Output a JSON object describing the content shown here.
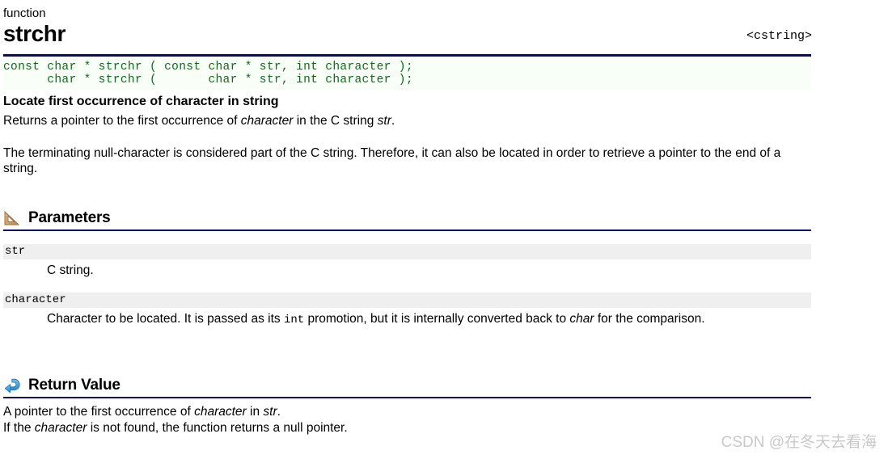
{
  "colors": {
    "rule_navy": "#0a0a64",
    "code_text_green": "#14691e",
    "code_bg": "#f7fff7",
    "param_band_gray": "#efefef",
    "watermark_gray": "#c9c9c9",
    "return_icon_blue": "#3c9ee0",
    "ruler_icon_tan": "#d8b083"
  },
  "header": {
    "kind": "function",
    "title": "strchr",
    "include": "<cstring>"
  },
  "prototype": {
    "lines": [
      "const char * strchr ( const char * str, int character );",
      "      char * strchr (       char * str, int character );"
    ]
  },
  "description": {
    "headline": "Locate first occurrence of character in string",
    "paragraph1_parts": [
      {
        "text": "Returns a pointer to the first occurrence of ",
        "style": "normal"
      },
      {
        "text": "character",
        "style": "italic"
      },
      {
        "text": " in the C string ",
        "style": "normal"
      },
      {
        "text": "str",
        "style": "italic"
      },
      {
        "text": ".",
        "style": "normal"
      }
    ],
    "paragraph1_plain": "Returns a pointer to the first occurrence of character in the C string str.",
    "paragraph2": "The terminating null-character is considered part of the C string. Therefore, it can also be located in order to retrieve a pointer to the end of a string."
  },
  "sections": {
    "parameters": {
      "icon": "ruler-triangle-icon",
      "title": "Parameters",
      "items": [
        {
          "name": "str",
          "description_plain": "C string.",
          "description_parts": [
            {
              "text": "C string.",
              "style": "normal"
            }
          ]
        },
        {
          "name": "character",
          "description_plain": "Character to be located. It is passed as its int promotion, but it is internally converted back to char for the comparison.",
          "description_parts": [
            {
              "text": "Character to be located. It is passed as its ",
              "style": "normal"
            },
            {
              "text": "int",
              "style": "mono"
            },
            {
              "text": " promotion, but it is internally converted back to ",
              "style": "normal"
            },
            {
              "text": "char",
              "style": "italic"
            },
            {
              "text": " for the comparison.",
              "style": "normal"
            }
          ]
        }
      ]
    },
    "return_value": {
      "icon": "return-arrow-icon",
      "title": "Return Value",
      "lines_plain": [
        "A pointer to the first occurrence of character in str.",
        "If the character is not found, the function returns a null pointer."
      ],
      "lines": [
        [
          {
            "text": "A pointer to the first occurrence of ",
            "style": "normal"
          },
          {
            "text": "character",
            "style": "italic"
          },
          {
            "text": " in ",
            "style": "normal"
          },
          {
            "text": "str",
            "style": "italic"
          },
          {
            "text": ".",
            "style": "normal"
          }
        ],
        [
          {
            "text": "If the ",
            "style": "normal"
          },
          {
            "text": "character",
            "style": "italic"
          },
          {
            "text": " is not found, the function returns a null pointer.",
            "style": "normal"
          }
        ]
      ]
    }
  },
  "watermark": {
    "text": "CSDN @在冬天去看海"
  }
}
